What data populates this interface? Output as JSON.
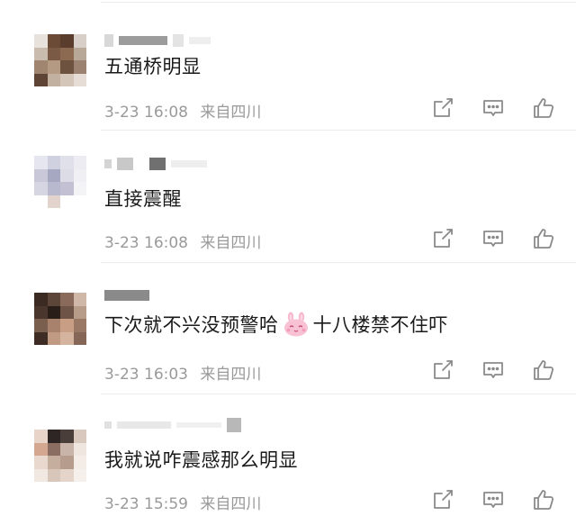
{
  "comments": [
    {
      "content": "五通桥明显",
      "date": "3-23",
      "time": "16:08",
      "source": "来自四川",
      "icons": [
        "share-icon",
        "comment-icon",
        "like-icon"
      ]
    },
    {
      "content": "直接震醒",
      "date": "3-23",
      "time": "16:08",
      "source": "来自四川",
      "icons": [
        "share-icon",
        "comment-icon",
        "like-icon"
      ]
    },
    {
      "content_before": "下次就不兴没预警哈",
      "emoji": "pink-bunny-emoji",
      "content_after": "十八楼禁不住吓",
      "date": "3-23",
      "time": "16:03",
      "source": "来自四川",
      "icons": [
        "share-icon",
        "comment-icon",
        "like-icon"
      ]
    },
    {
      "content": "我就说咋震感那么明显",
      "date": "3-23",
      "time": "15:59",
      "source": "来自四川",
      "icons": [
        "share-icon",
        "comment-icon",
        "like-icon"
      ]
    }
  ],
  "colors": {
    "text": "#1a1a1a",
    "meta": "#9a9a9a",
    "icon": "#8a8a8a",
    "divider": "#ececec"
  }
}
